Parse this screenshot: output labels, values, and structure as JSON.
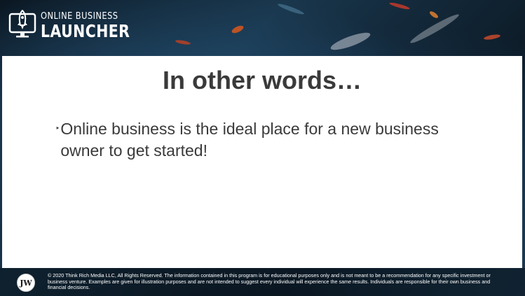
{
  "header": {
    "logo_line1": "ONLINE BUSINESS",
    "logo_line2": "LAUNCHER",
    "logo_icon": "rocket-monitor-icon"
  },
  "slide": {
    "title": "In other words…",
    "bullets": [
      {
        "marker": "‣",
        "text": "Online business is the ideal place for a new business owner to get started!"
      }
    ]
  },
  "footer": {
    "badge_text": "JW",
    "copyright": "© 2020 Think Rich Media LLC, All Rights Reserved. The information contained in this program is for educational purposes only and is not meant to be a recommendation for any specific investment or business venture. Examples are given for illustration purposes and are not intended to suggest every individual will experience the same results. Individuals are responsible for their own business and financial decisions."
  },
  "colors": {
    "title_text": "#3a3a3a",
    "content_bg": "#ffffff",
    "header_bg": "#19364c",
    "accent_paint": "#d8571f"
  }
}
